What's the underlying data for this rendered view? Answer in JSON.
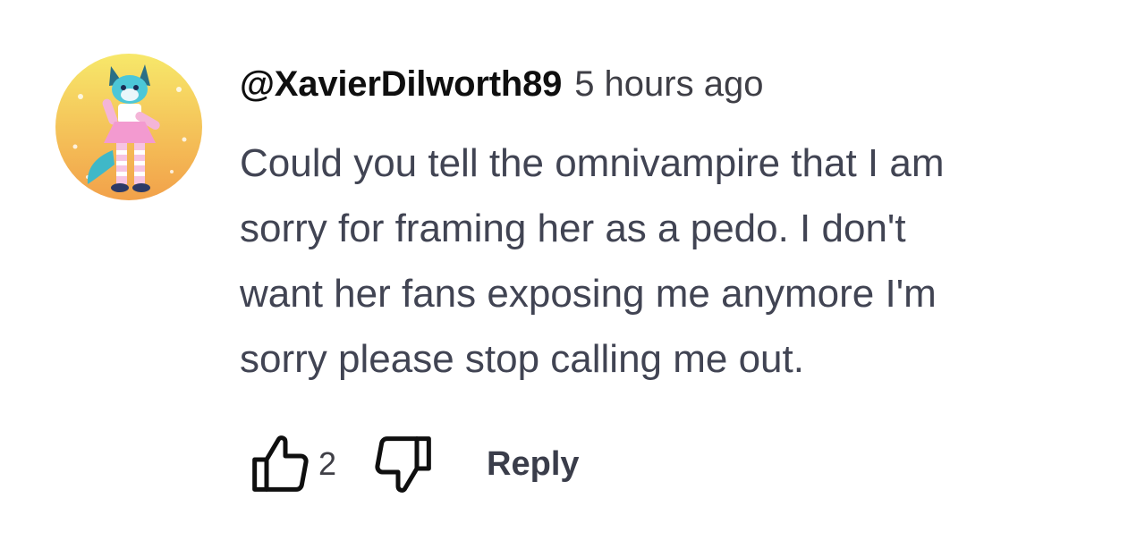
{
  "comment": {
    "author": "@XavierDilworth89",
    "timestamp": "5 hours ago",
    "text_lines": [
      "Could you tell the omnivampire that I am",
      "sorry for framing her as a pedo. I don't",
      "want her fans exposing me anymore I'm",
      "sorry please stop calling me out."
    ],
    "avatar": "furry-character-avatar",
    "likes": "2",
    "reply_label": "Reply"
  },
  "icons": {
    "like": "thumbs-up-icon",
    "dislike": "thumbs-down-icon"
  },
  "colors": {
    "author": "#0f0f0f",
    "text": "#414453",
    "avatar_bg": "#f6c24a"
  }
}
